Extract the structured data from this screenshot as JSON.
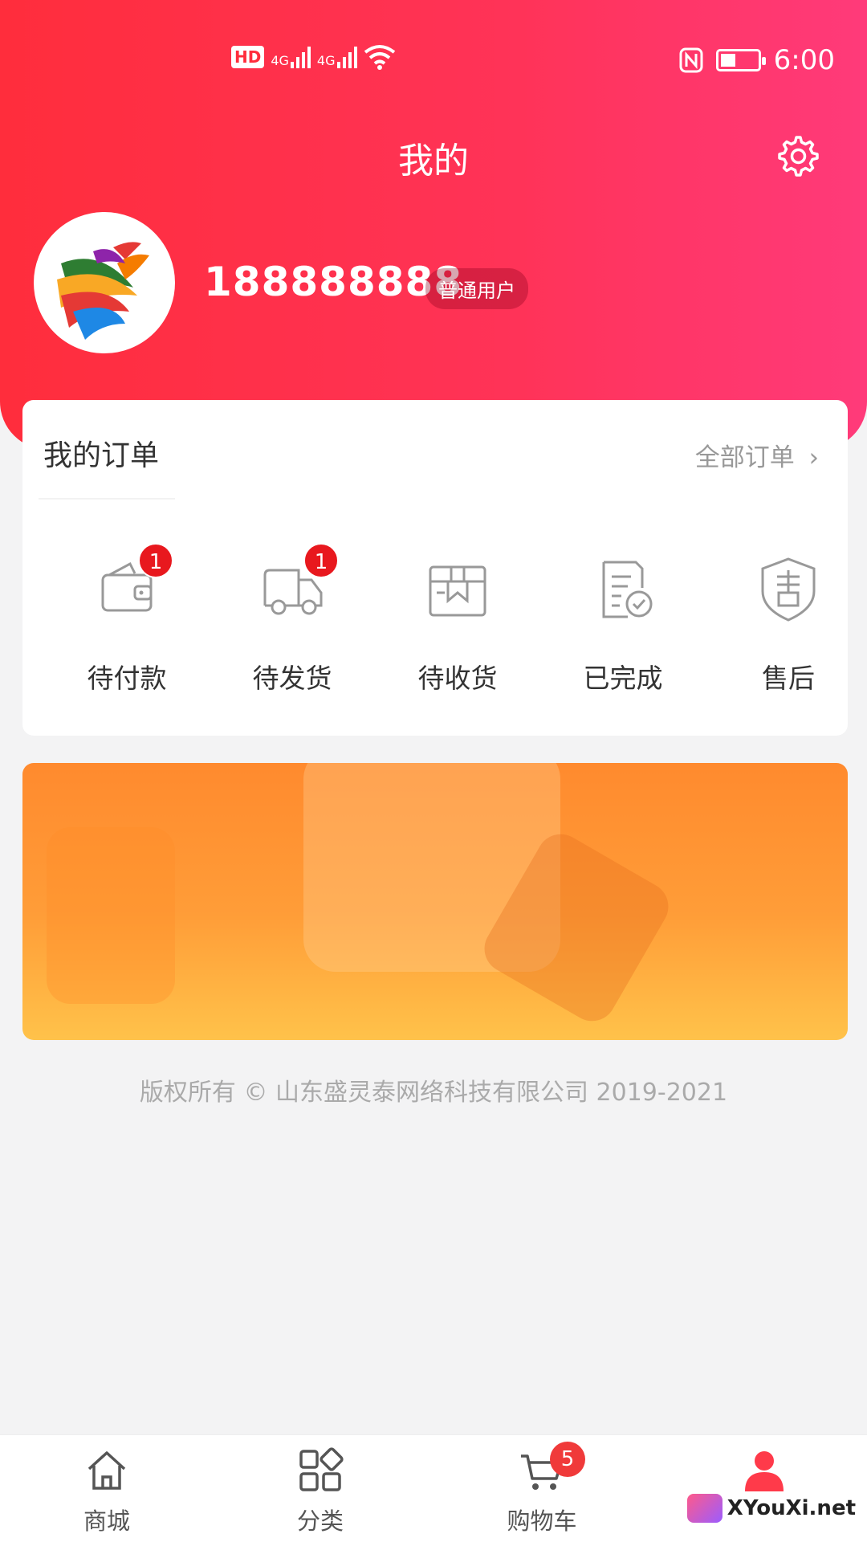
{
  "status_bar": {
    "network_left": "HD",
    "sim1": "4G",
    "sim2": "4G",
    "time": "6:00",
    "accent": "#ffffff"
  },
  "header": {
    "title": "我的",
    "settings_icon": "gear-icon",
    "gradient_start": "#ff2d3c",
    "gradient_end": "#ff3a7a"
  },
  "profile": {
    "phone": "188888888",
    "user_type": "普通用户",
    "avatar_icon": "phoenix-logo"
  },
  "orders": {
    "title": "我的订单",
    "all_label": "全部订单",
    "items": [
      {
        "label": "待付款",
        "icon": "wallet-icon",
        "badge": "1"
      },
      {
        "label": "待发货",
        "icon": "truck-icon",
        "badge": "1"
      },
      {
        "label": "待收货",
        "icon": "box-icon",
        "badge": ""
      },
      {
        "label": "已完成",
        "icon": "checklist-icon",
        "badge": ""
      },
      {
        "label": "售后",
        "icon": "shield-icon",
        "badge": ""
      }
    ]
  },
  "banner": {
    "colors": [
      "#ff8a2e",
      "#ffc24a"
    ]
  },
  "footer": {
    "copyright": "版权所有 © 山东盛灵泰网络科技有限公司 2019-2021"
  },
  "tabbar": {
    "items": [
      {
        "label": "商城",
        "icon": "home-icon"
      },
      {
        "label": "分类",
        "icon": "grid-icon"
      },
      {
        "label": "购物车",
        "icon": "cart-icon",
        "badge": "5"
      },
      {
        "label": "",
        "icon": "user-icon",
        "active": true
      }
    ],
    "active_color": "#ff3a4a"
  },
  "watermark": {
    "text": "XYouXi.net"
  }
}
